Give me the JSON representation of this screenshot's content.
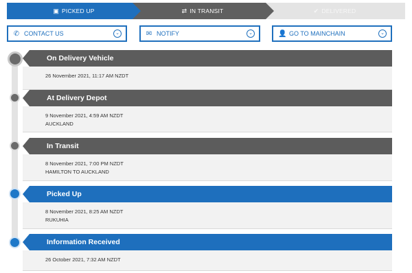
{
  "stepper": {
    "steps": [
      {
        "label": "Picked Up",
        "icon": "box-icon",
        "glyph": "▣",
        "state": "complete"
      },
      {
        "label": "In Transit",
        "icon": "transfer-arrows-icon",
        "glyph": "⇄",
        "state": "current"
      },
      {
        "label": "Delivered",
        "icon": "check-icon",
        "glyph": "✔",
        "state": "pending"
      }
    ]
  },
  "actions": [
    {
      "label": "CONTACT US",
      "icon": "phone-icon",
      "glyph": "✆",
      "chevron": "⌄"
    },
    {
      "label": "NOTIFY",
      "icon": "envelope-icon",
      "glyph": "✉",
      "chevron": "⌄"
    },
    {
      "label": "GO TO MAINCHAIN",
      "icon": "person-icon",
      "glyph": "👤",
      "chevron": "⌄"
    }
  ],
  "timeline": [
    {
      "title": "On Delivery Vehicle",
      "datetime": "26 November 2021, 11:17 AM NZDT",
      "location": "",
      "color": "grey"
    },
    {
      "title": "At Delivery Depot",
      "datetime": "9 November 2021, 4:59 AM NZDT",
      "location": "AUCKLAND",
      "color": "grey"
    },
    {
      "title": "In Transit",
      "datetime": "8 November 2021, 7:00 PM NZDT",
      "location": "HAMILTON to AUCKLAND",
      "color": "grey"
    },
    {
      "title": "Picked Up",
      "datetime": "8 November 2021, 8:25 AM NZDT",
      "location": "RUKUHIA",
      "color": "blue"
    },
    {
      "title": "Information Received",
      "datetime": "26 October 2021, 7:32 AM NZDT",
      "location": "",
      "color": "blue"
    }
  ],
  "colors": {
    "accent": "#1e6fbd",
    "grey": "#5c5c5c",
    "pending": "#e4e4e4"
  }
}
